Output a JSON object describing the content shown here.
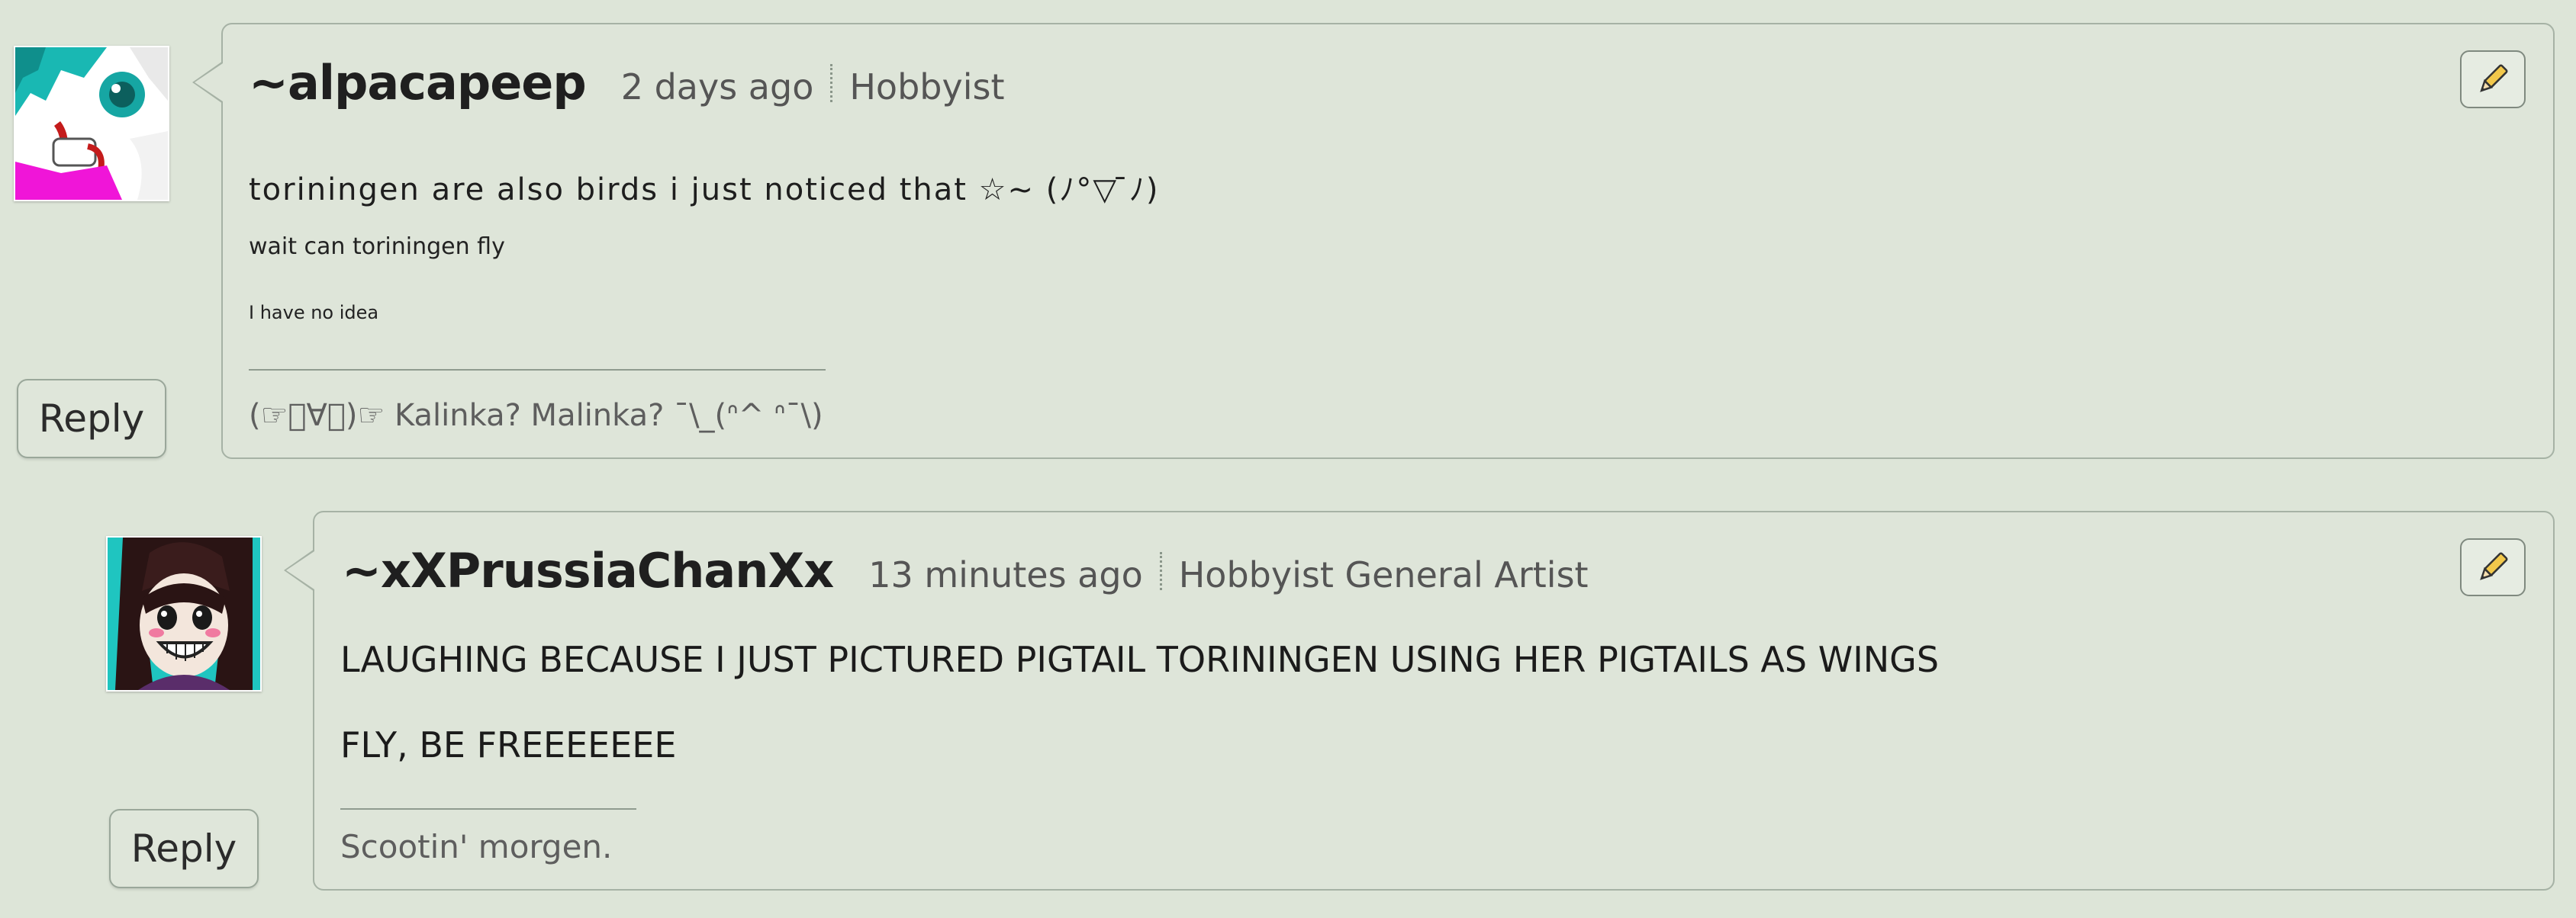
{
  "comments": [
    {
      "username": "~alpacapeep",
      "time": "2 days ago",
      "role": "Hobbyist",
      "body": [
        "toriningen are also birds i just noticed that ☆~ (ﾉ°▽ ̄ﾉ)",
        "wait can toriningen fly",
        "I have no idea"
      ],
      "signature": "(☞ﾟ∀ﾟ)☞ Kalinka? Malinka? ¯\\_(ᐢ^ ᐢ¯\\)",
      "reply_label": "Reply",
      "avatar": "avatar-anime-cyan-hair"
    },
    {
      "username": "~xXPrussiaChanXx",
      "time": "13 minutes ago",
      "role": "Hobbyist General Artist",
      "body": [
        "LAUGHING BECAUSE I JUST PICTURED PIGTAIL TORININGEN USING HER PIGTAILS AS WINGS",
        "FLY, BE FREEEEEEE"
      ],
      "signature": "Scootin' morgen.",
      "reply_label": "Reply",
      "avatar": "avatar-anime-grinning-girl"
    }
  ],
  "colors": {
    "background": "#dde5d8",
    "bubble": "#dee5d9",
    "border": "#a6b2a5",
    "edit_icon": "pencil-icon"
  }
}
